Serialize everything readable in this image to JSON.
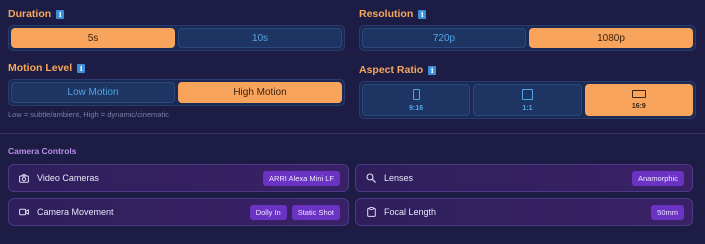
{
  "duration": {
    "title": "Duration",
    "options": [
      "5s",
      "10s"
    ],
    "selected": "5s"
  },
  "resolution": {
    "title": "Resolution",
    "options": [
      "720p",
      "1080p"
    ],
    "selected": "1080p"
  },
  "motion_level": {
    "title": "Motion Level",
    "options": [
      "Low Motion",
      "High Motion"
    ],
    "selected": "High Motion",
    "hint": "Low = subtle/ambient, High = dynamic/cinematic"
  },
  "aspect_ratio": {
    "title": "Aspect Ratio",
    "options": [
      "9:16",
      "1:1",
      "16:9"
    ],
    "selected": "16:9"
  },
  "camera_controls": {
    "title": "Camera Controls",
    "video_cameras": {
      "label": "Video Cameras",
      "chips": [
        "ARRI Alexa Mini LF"
      ]
    },
    "lenses": {
      "label": "Lenses",
      "chips": [
        "Anamorphic"
      ]
    },
    "camera_movement": {
      "label": "Camera Movement",
      "chips": [
        "Dolly In",
        "Static Shot"
      ]
    },
    "focal_length": {
      "label": "Focal Length",
      "chips": [
        "50mm"
      ]
    }
  },
  "icons": {
    "info": "info-icon",
    "video_cameras": "camera-icon",
    "lenses": "search-icon",
    "camera_movement": "video-camera-icon",
    "focal_length": "clipboard-icon"
  },
  "colors": {
    "background": "#1c1c44",
    "accent_orange": "#f8a45c",
    "inactive_text": "#4fa6e6",
    "chip_purple": "#6a33c4",
    "section_purple": "#b98fe8"
  }
}
